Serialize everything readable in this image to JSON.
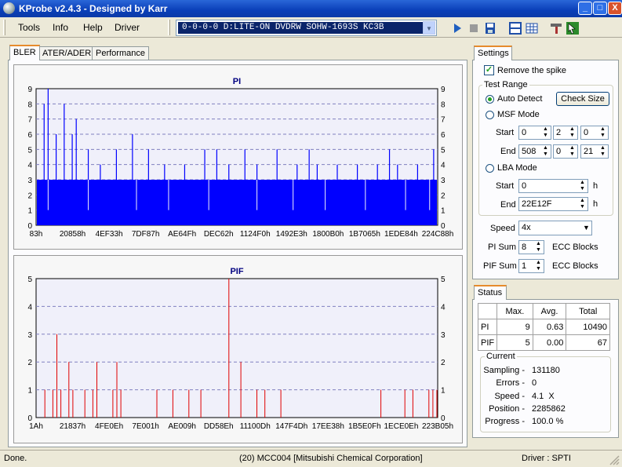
{
  "window": {
    "title": "KProbe v2.4.3 - Designed by Karr",
    "min": "_",
    "max": "□",
    "close": "X"
  },
  "menu": [
    "Tools",
    "Info",
    "Help",
    "Driver"
  ],
  "drive_select": {
    "value": "0-0-0-0 D:LITE-ON DVDRW SOHW-1693S KC3B"
  },
  "toolbar": {
    "icons": [
      "play-icon",
      "stop-icon",
      "save-icon",
      "layout-icon",
      "grid-icon",
      "tools-icon",
      "help-icon"
    ]
  },
  "tabs": [
    "BLER",
    "ATER/ADER",
    "Performance"
  ],
  "pi_chart": {
    "title": "PI",
    "xticks": [
      "83h",
      "20858h",
      "4EF33h",
      "7DF87h",
      "AE64Fh",
      "DEC62h",
      "1124F0h",
      "1492E3h",
      "1800B0h",
      "1B7065h",
      "1EDE84h",
      "224C88h"
    ],
    "yticks": [
      "0",
      "1",
      "2",
      "3",
      "4",
      "5",
      "6",
      "7",
      "8",
      "9"
    ]
  },
  "pif_chart": {
    "title": "PIF",
    "xticks": [
      "1Ah",
      "21837h",
      "4FE0Eh",
      "7E001h",
      "AE009h",
      "DD58Eh",
      "11100Dh",
      "147F4Dh",
      "17EE38h",
      "1B5E0Fh",
      "1ECE0Eh",
      "223B05h"
    ],
    "yticks": [
      "0",
      "1",
      "2",
      "3",
      "4",
      "5"
    ]
  },
  "chart_data": [
    {
      "type": "bar",
      "title": "PI",
      "ylim": [
        0,
        9
      ],
      "baseline": 3,
      "color": "#0000ff",
      "peaks": [
        [
          0.02,
          8
        ],
        [
          0.03,
          9
        ],
        [
          0.05,
          6
        ],
        [
          0.07,
          8
        ],
        [
          0.09,
          6
        ],
        [
          0.1,
          7
        ],
        [
          0.13,
          5
        ],
        [
          0.16,
          4
        ],
        [
          0.2,
          5
        ],
        [
          0.24,
          6
        ],
        [
          0.28,
          5
        ],
        [
          0.32,
          4
        ],
        [
          0.37,
          4
        ],
        [
          0.42,
          5
        ],
        [
          0.45,
          5
        ],
        [
          0.48,
          4
        ],
        [
          0.52,
          5
        ],
        [
          0.55,
          4
        ],
        [
          0.6,
          5
        ],
        [
          0.65,
          4
        ],
        [
          0.68,
          5
        ],
        [
          0.7,
          4
        ],
        [
          0.75,
          4
        ],
        [
          0.8,
          4
        ],
        [
          0.85,
          4
        ],
        [
          0.88,
          5
        ],
        [
          0.9,
          4
        ],
        [
          0.95,
          4
        ],
        [
          0.99,
          5
        ]
      ],
      "dips": [
        0.03,
        0.13,
        0.25,
        0.33,
        0.43,
        0.55,
        0.64,
        0.72,
        0.82,
        0.92,
        0.98
      ]
    },
    {
      "type": "bar",
      "title": "PIF",
      "ylim": [
        0,
        5
      ],
      "color": "#e00000",
      "x": [
        0.02,
        0.04,
        0.05,
        0.06,
        0.08,
        0.09,
        0.12,
        0.14,
        0.15,
        0.19,
        0.2,
        0.21,
        0.2,
        0.3,
        0.34,
        0.38,
        0.41,
        0.48,
        0.51,
        0.55,
        0.57,
        0.61,
        0.86,
        0.92,
        0.94,
        0.98,
        0.99,
        1.0
      ],
      "y": [
        1,
        1,
        3,
        1,
        2,
        1,
        1,
        1,
        2,
        1,
        1,
        1,
        2,
        1,
        1,
        1,
        1,
        5,
        2,
        1,
        1,
        1,
        1,
        1,
        1,
        1,
        1,
        1
      ]
    }
  ],
  "settings": {
    "tab": "Settings",
    "remove_spike": "Remove the spike",
    "test_range": "Test Range",
    "auto_detect": "Auto Detect",
    "check_size": "Check Size",
    "msf_mode": "MSF Mode",
    "start": "Start",
    "end": "End",
    "msf_start": [
      "0",
      "2",
      "0"
    ],
    "msf_end": [
      "508",
      "0",
      "21"
    ],
    "lba_mode": "LBA Mode",
    "lba_start": "0",
    "lba_end": "22E12F",
    "h": "h",
    "speed_label": "Speed",
    "speed_value": "4x",
    "pi_sum_label": "PI Sum",
    "pi_sum_value": "8",
    "pif_sum_label": "PIF Sum",
    "pif_sum_value": "1",
    "ecc_blocks": "ECC Blocks"
  },
  "status": {
    "tab": "Status",
    "headers": [
      "",
      "Max.",
      "Avg.",
      "Total"
    ],
    "rows": [
      [
        "PI",
        "9",
        "0.63",
        "10490"
      ],
      [
        "PIF",
        "5",
        "0.00",
        "67"
      ]
    ],
    "current": "Current",
    "fields": [
      {
        "label": "Sampling -",
        "value": "131180"
      },
      {
        "label": "Errors -",
        "value": "0"
      },
      {
        "label": "Speed -",
        "value": "4.1  X"
      },
      {
        "label": "Position -",
        "value": "2285862"
      },
      {
        "label": "Progress -",
        "value": "100.0 %"
      }
    ]
  },
  "statusbar": {
    "left": "Done.",
    "center": "(20) MCC004 [Mitsubishi Chemical Corporation]",
    "right": "Driver : SPTI"
  }
}
